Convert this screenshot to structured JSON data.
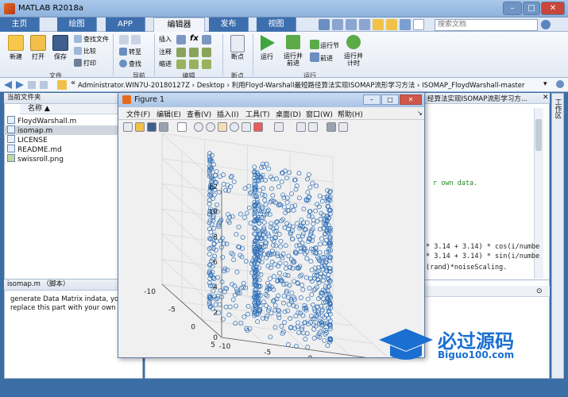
{
  "window": {
    "title": "MATLAB R2018a",
    "min": "–",
    "max": "□",
    "close": "✕"
  },
  "tabs": [
    {
      "label": "主页"
    },
    {
      "label": "绘图"
    },
    {
      "label": "APP"
    },
    {
      "label": "编辑器"
    },
    {
      "label": "发布"
    },
    {
      "label": "视图"
    }
  ],
  "search_placeholder": "搜索文档",
  "ribbon": {
    "file": {
      "new": "新建",
      "open": "打开",
      "save": "保存",
      "find_files": "查找文件",
      "compare": "比较",
      "print": "打印",
      "group": "文件"
    },
    "navigate": {
      "goto": "转至",
      "find": "查找",
      "group": "导航"
    },
    "edit": {
      "insert": "插入",
      "comment": "注释",
      "indent": "缩进",
      "fx": "fx",
      "group": "编辑"
    },
    "breakpoints": {
      "label": "断点",
      "group": "断点"
    },
    "run": {
      "run": "运行",
      "run_advance": "运行并\n前进",
      "run_section": "运行节",
      "advance": "前进",
      "run_time": "运行并\n计时",
      "group": "运行"
    }
  },
  "address": {
    "sep": "«",
    "path": "Administrator.WIN7U-20180127Z  ›  Desktop  ›  利用Floyd-Warshall最短路径算法实现ISOMAP流形学习方法  ›  ISOMAP_FloydWarshall-master"
  },
  "current_folder": {
    "title": "当前文件夹",
    "column": "名称 ▲",
    "files": [
      "FloydWarshall.m",
      "isomap.m",
      "LICENSE",
      "README.md",
      "swissroll.png"
    ]
  },
  "details": {
    "title": "isomap.m （脚本）",
    "text1": "generate Data Matrix indata, you c",
    "text2": "replace this part with your own da"
  },
  "editor": {
    "tab_text": "经算法实现ISOMAP流形学习方...",
    "line1": "r own data.",
    "line2": "* 3.14 + 3.14) * cos(i/numbe",
    "line3": "* 3.14 + 3.14) * sin(i/numbe",
    "line4": "(rand)*noiseScaling."
  },
  "side_tab": "工作区",
  "figure": {
    "title": "Figure 1",
    "menus": [
      "文件(F)",
      "编辑(E)",
      "查看(V)",
      "插入(I)",
      "工具(T)",
      "桌面(D)",
      "窗口(W)",
      "帮助(H)"
    ],
    "zticks": [
      "0",
      "2",
      "4",
      "6",
      "8",
      "10",
      "12"
    ],
    "yticks": [
      "5",
      "0",
      "-5",
      "-10"
    ],
    "xticks": [
      "-10",
      "-5",
      "0",
      "5",
      "10"
    ],
    "marker_color": "#2e6eb5"
  },
  "chart_data": {
    "type": "scatter",
    "x_range": [
      -10,
      10
    ],
    "y_range": [
      -10,
      5
    ],
    "z_range": [
      0,
      12
    ],
    "marker": "circle",
    "description_shape": "swiss roll"
  },
  "logo": {
    "cn": "必过源码",
    "en": "Biguo100.com"
  }
}
